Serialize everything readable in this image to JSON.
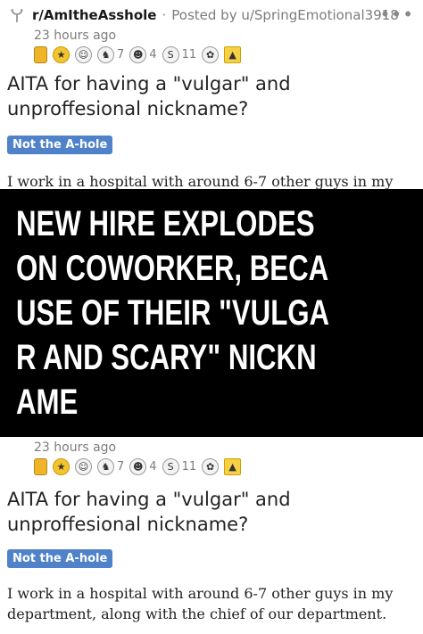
{
  "post_top": {
    "subreddit": "r/AmItheAsshole",
    "separator": "·",
    "posted_by": "Posted by u/SpringEmotional3918",
    "time": "23 hours ago",
    "award_counts": [
      "7",
      "4",
      "11"
    ],
    "title": "AITA for having a \"vulgar\" and unproffesional nickname?",
    "flair": "Not the A-hole",
    "body": "I work in a hospital with around 6-7 other guys in my"
  },
  "overlay": {
    "headline": "NEW HIRE EXPLODES ON COWORKER, BECAUSE OF THEIR \"VULGAR AND SCARY\" NICKNAME",
    "background_color": "#000000",
    "text_color": "#ffffff"
  },
  "post_bottom": {
    "time": "23 hours ago",
    "award_counts": [
      "7",
      "4",
      "11"
    ],
    "title": "AITA for having a \"vulgar\" and unproffesional nickname?",
    "flair": "Not the A-hole",
    "body": "I work in a hospital with around 6-7 other guys in my department, along with the chief of our department."
  },
  "icons": {
    "subreddit": "subreddit-icon",
    "more": "more-options-icon"
  },
  "colors": {
    "flair_bg": "#4f82c9",
    "meta_text": "#7c7c7c"
  }
}
